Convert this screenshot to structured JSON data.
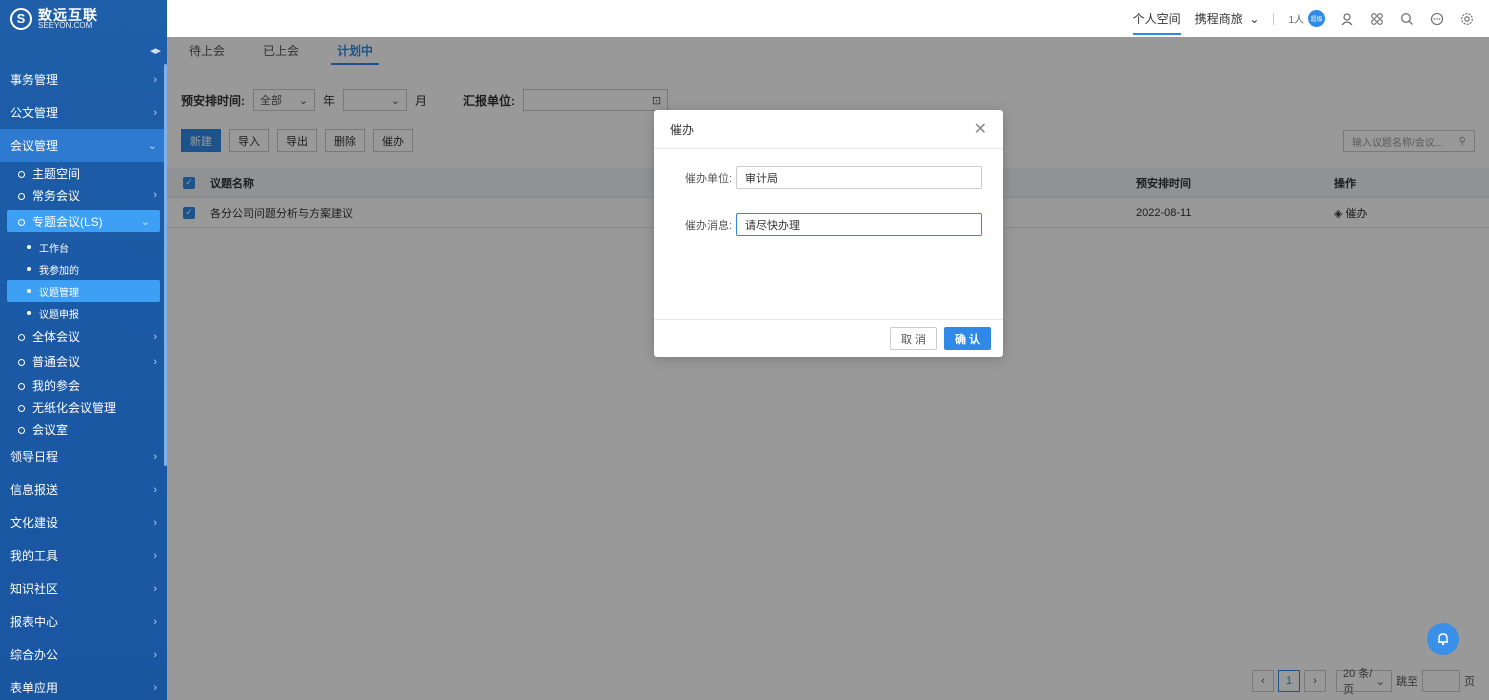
{
  "logo": {
    "cn": "致远互联",
    "en": "SEEYON.COM"
  },
  "topbar": {
    "personal_space": "个人空间",
    "travel": "携程商旅",
    "count": "1人",
    "badge": "超级"
  },
  "sidebar": {
    "groups_top": [
      "事务管理",
      "公文管理"
    ],
    "active_group": "会议管理",
    "subs": [
      {
        "label": "主题空间",
        "chev": false
      },
      {
        "label": "常务会议",
        "chev": true
      }
    ],
    "special": "专题会议(LS)",
    "subsubs": [
      "工作台",
      "我参加的",
      "议题管理",
      "议题申报"
    ],
    "subs2": [
      {
        "label": "全体会议",
        "chev": true
      },
      {
        "label": "普通会议",
        "chev": true
      },
      {
        "label": "我的参会",
        "chev": false
      },
      {
        "label": "无纸化会议管理",
        "chev": false
      },
      {
        "label": "会议室",
        "chev": false
      }
    ],
    "groups_bottom": [
      "领导日程",
      "信息报送",
      "文化建设",
      "我的工具",
      "知识社区",
      "报表中心",
      "综合办公",
      "表单应用"
    ]
  },
  "tabs": [
    "待上会",
    "已上会",
    "计划中"
  ],
  "filter": {
    "time_label": "预安排时间:",
    "all": "全部",
    "year": "年",
    "month": "月",
    "unit_label": "汇报单位:"
  },
  "actions": [
    "新建",
    "导入",
    "导出",
    "删除",
    "催办"
  ],
  "search_placeholder": "输入议题名称/会议...",
  "table": {
    "headers": {
      "name": "议题名称",
      "date": "预安排时间",
      "op": "操作"
    },
    "rows": [
      {
        "name": "各分公司问题分析与方案建议",
        "date": "2022-08-11",
        "op": "催办"
      }
    ]
  },
  "pager": {
    "page": "1",
    "size": "20 条/页",
    "jump": "跳至",
    "page_unit": "页"
  },
  "dialog": {
    "title": "催办",
    "unit_label": "催办单位:",
    "unit_value": "审计局",
    "msg_label": "催办消息:",
    "msg_value": "请尽快办理",
    "cancel": "取 消",
    "confirm": "确 认"
  }
}
